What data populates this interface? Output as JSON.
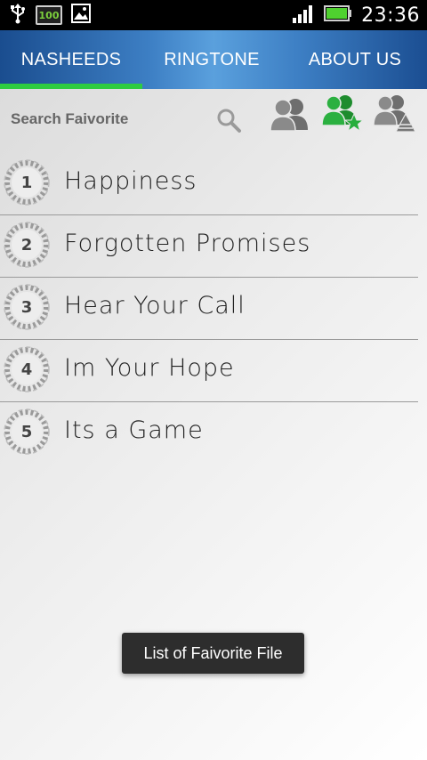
{
  "status_bar": {
    "battery_badge": "100",
    "clock": "23:36",
    "icons": [
      "usb-icon",
      "battery-100-badge-icon",
      "gallery-icon",
      "signal-icon",
      "battery-icon"
    ]
  },
  "tabs": [
    {
      "label": "NASHEEDS",
      "active": true
    },
    {
      "label": "RINGTONE",
      "active": false
    },
    {
      "label": "ABOUT US",
      "active": false
    }
  ],
  "search": {
    "placeholder": "Search Faivorite",
    "value": ""
  },
  "toolbar_icons": [
    "search-icon",
    "users-icon",
    "favorite-users-icon",
    "ringtone-users-icon"
  ],
  "colors": {
    "accent_green": "#2ecc40",
    "tab_blue": "#3d7fc4",
    "icon_gray": "#7a7a7a",
    "favorite_green": "#27ae3c"
  },
  "items": [
    {
      "number": "1",
      "title": "Happiness"
    },
    {
      "number": "2",
      "title": "Forgotten Promises"
    },
    {
      "number": "3",
      "title": "Hear Your Call"
    },
    {
      "number": "4",
      "title": "Im Your Hope"
    },
    {
      "number": "5",
      "title": "Its a Game"
    }
  ],
  "toast": "List of Faivorite File"
}
